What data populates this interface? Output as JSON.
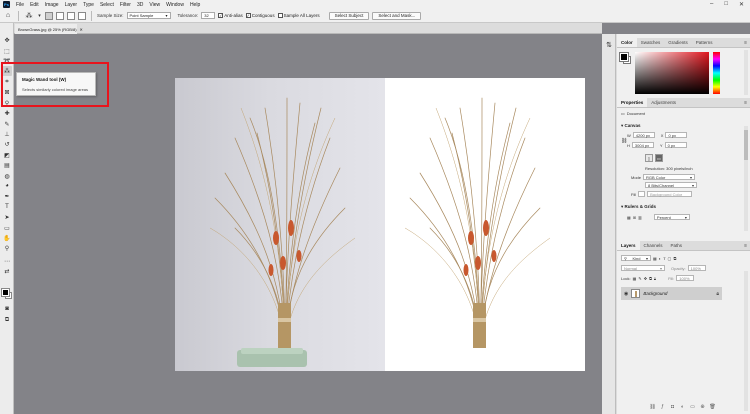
{
  "app": {
    "logo_text": "Ps",
    "menus": [
      "File",
      "Edit",
      "Image",
      "Layer",
      "Type",
      "Select",
      "Filter",
      "3D",
      "View",
      "Window",
      "Help"
    ],
    "window_controls": [
      "–",
      "□",
      "✕"
    ]
  },
  "options_bar": {
    "sample_size_label": "Sample Size:",
    "sample_size_value": "Point Sample",
    "tolerance_label": "Tolerance:",
    "tolerance_value": "32",
    "anti_alias_label": "Anti-alias",
    "anti_alias_checked": true,
    "contiguous_label": "Contiguous",
    "contiguous_checked": true,
    "sample_all_layers_label": "Sample All Layers",
    "sample_all_layers_checked": false,
    "select_subject_label": "Select Subject",
    "select_and_mask_label": "Select and Mask..."
  },
  "document": {
    "tab_title": "BrownGrass.jpg @ 25% (RGB/8)",
    "close_glyph": "✕"
  },
  "tooltip": {
    "title": "Magic Wand tool (W)",
    "description": "Selects similarly colored image areas"
  },
  "color_panel": {
    "tabs": [
      "Color",
      "Swatches",
      "Gradients",
      "Patterns"
    ],
    "active_tab": 0,
    "foreground_color": "#000000",
    "background_color": "#ffffff"
  },
  "properties_panel": {
    "tabs": [
      "Properties",
      "Adjustments"
    ],
    "document_label": "Document",
    "canvas_section": "Canvas",
    "w_label": "W",
    "w_value": "4200 px",
    "h_label": "H",
    "h_value": "3004 px",
    "x_label": "X",
    "x_value": "0 px",
    "y_label": "Y",
    "y_value": "0 px",
    "resolution_text": "Resolution: 300 pixels/inch",
    "mode_label": "Mode",
    "mode_value": "RGB Color",
    "bit_depth_value": "8 Bits/Channel",
    "fill_label": "Fill",
    "fill_value": "Background Color",
    "rulers_section": "Rulers & Grids",
    "percent_value": "Percent"
  },
  "layers_panel": {
    "tabs": [
      "Layers",
      "Channels",
      "Paths"
    ],
    "kind_value": "Kind",
    "blend_mode_value": "Normal",
    "opacity_label": "Opacity:",
    "opacity_value": "100%",
    "lock_label": "Lock:",
    "fill_label": "Fill:",
    "fill_value": "100%",
    "layer_name": "Background"
  }
}
